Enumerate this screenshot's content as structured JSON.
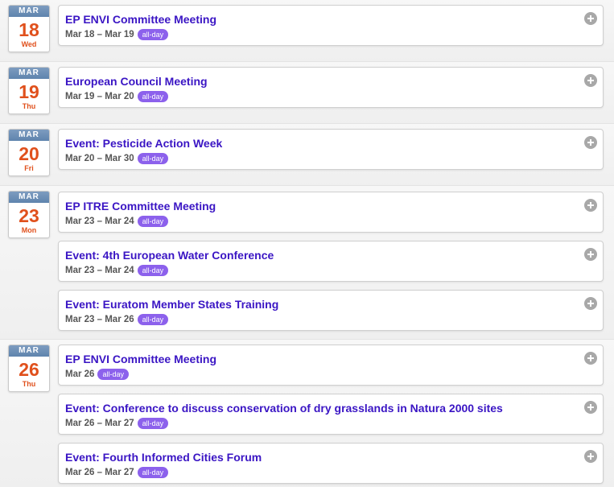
{
  "days": [
    {
      "month": "MAR",
      "day": "18",
      "weekday": "Wed",
      "events": [
        {
          "title": "EP ENVI Committee Meeting",
          "dates": "Mar 18 – Mar 19",
          "badge": "all-day"
        }
      ]
    },
    {
      "month": "MAR",
      "day": "19",
      "weekday": "Thu",
      "events": [
        {
          "title": "European Council Meeting",
          "dates": "Mar 19 – Mar 20",
          "badge": "all-day"
        }
      ]
    },
    {
      "month": "MAR",
      "day": "20",
      "weekday": "Fri",
      "events": [
        {
          "title": "Event: Pesticide Action Week",
          "dates": "Mar 20 – Mar 30",
          "badge": "all-day"
        }
      ]
    },
    {
      "month": "MAR",
      "day": "23",
      "weekday": "Mon",
      "events": [
        {
          "title": "EP ITRE Committee Meeting",
          "dates": "Mar 23 – Mar 24",
          "badge": "all-day"
        },
        {
          "title": "Event: 4th European Water Conference",
          "dates": "Mar 23 – Mar 24",
          "badge": "all-day"
        },
        {
          "title": "Event: Euratom Member States Training",
          "dates": "Mar 23 – Mar 26",
          "badge": "all-day"
        }
      ]
    },
    {
      "month": "MAR",
      "day": "26",
      "weekday": "Thu",
      "events": [
        {
          "title": "EP ENVI Committee Meeting",
          "dates": "Mar 26",
          "badge": "all-day"
        },
        {
          "title": "Event: Conference to discuss conservation of dry grasslands in Natura 2000 sites",
          "dates": "Mar 26 – Mar 27",
          "badge": "all-day"
        },
        {
          "title": "Event: Fourth Informed Cities Forum",
          "dates": "Mar 26 – Mar 27",
          "badge": "all-day"
        }
      ]
    }
  ],
  "icons": {
    "add": "plus-circle-icon"
  }
}
